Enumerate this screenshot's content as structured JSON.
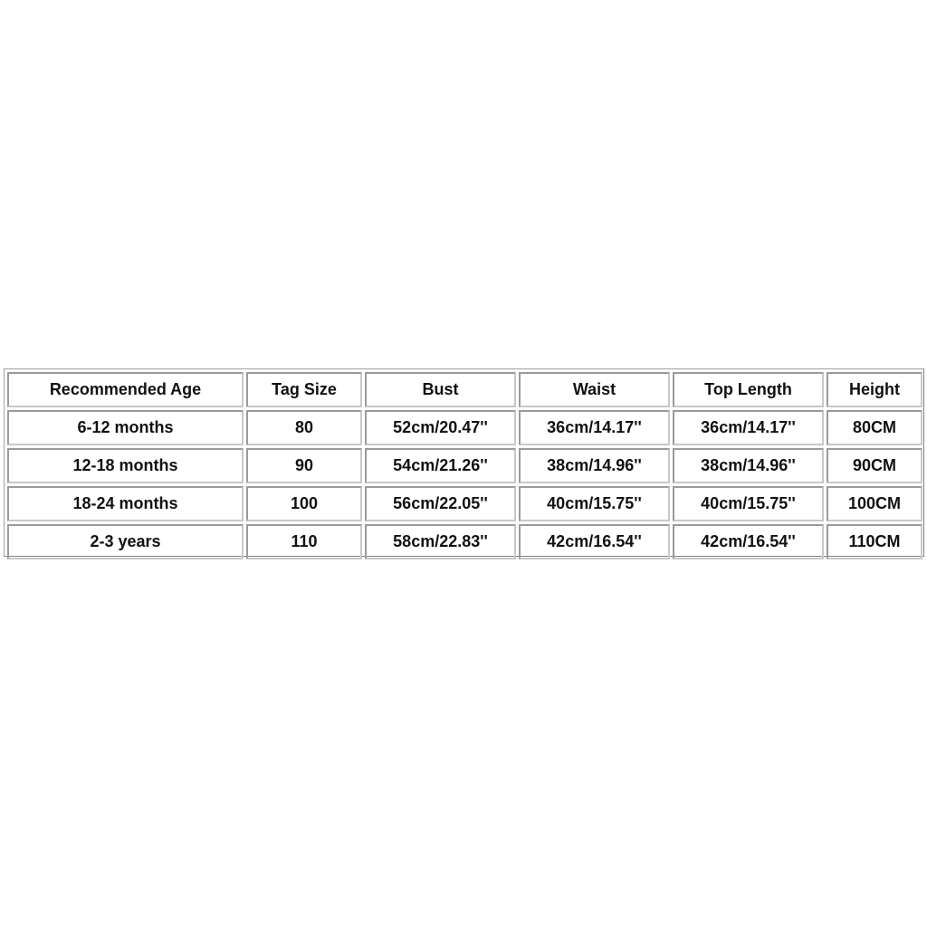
{
  "size_chart": {
    "columns": [
      "Recommended Age",
      "Tag Size",
      "Bust",
      "Waist",
      "Top Length",
      "Height"
    ],
    "rows": [
      [
        "6-12 months",
        "80",
        "52cm/20.47''",
        "36cm/14.17''",
        "36cm/14.17''",
        "80CM"
      ],
      [
        "12-18 months",
        "90",
        "54cm/21.26''",
        "38cm/14.96''",
        "38cm/14.96''",
        "90CM"
      ],
      [
        "18-24 months",
        "100",
        "56cm/22.05''",
        "40cm/15.75''",
        "40cm/15.75''",
        "100CM"
      ],
      [
        "2-3 years",
        "110",
        "58cm/22.83''",
        "42cm/16.54''",
        "42cm/16.54''",
        "110CM"
      ]
    ]
  }
}
